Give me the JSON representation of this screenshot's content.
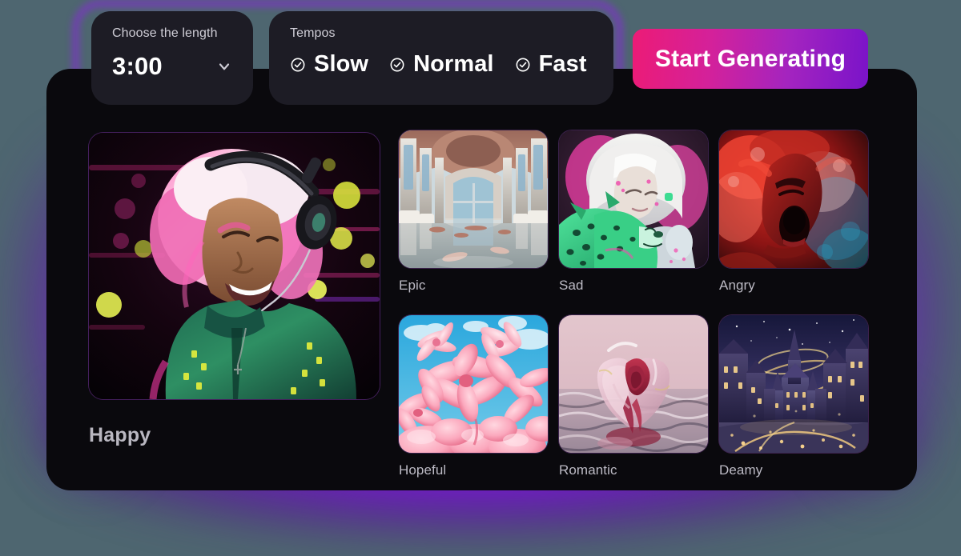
{
  "controls": {
    "length": {
      "caption": "Choose the length",
      "value": "3:00",
      "chevron_icon": "chevron-down-icon"
    },
    "tempos": {
      "caption": "Tempos",
      "options": [
        {
          "label": "Slow",
          "icon": "check-circle-icon"
        },
        {
          "label": "Normal",
          "icon": "check-circle-icon"
        },
        {
          "label": "Fast",
          "icon": "check-circle-icon"
        }
      ]
    },
    "cta": {
      "label": "Start Generating",
      "gradient_from": "#ec1b76",
      "gradient_to": "#7a13c9"
    }
  },
  "featured": {
    "label": "Happy",
    "art": "happy-headphones-portrait"
  },
  "moods": [
    {
      "label": "Epic",
      "art": "epic-cathedral"
    },
    {
      "label": "Sad",
      "art": "sad-girl-leopard"
    },
    {
      "label": "Angry",
      "art": "angry-red-scream"
    },
    {
      "label": "Hopeful",
      "art": "hopeful-pink-flowers"
    },
    {
      "label": "Romantic",
      "art": "romantic-glass-heart"
    },
    {
      "label": "Deamy",
      "art": "dreamy-night-castle"
    }
  ],
  "theme": {
    "card_bg": "#0a090d",
    "panel_bg": "#1d1c25",
    "glow": "#8c14f0",
    "page_bg": "#4e6670"
  }
}
